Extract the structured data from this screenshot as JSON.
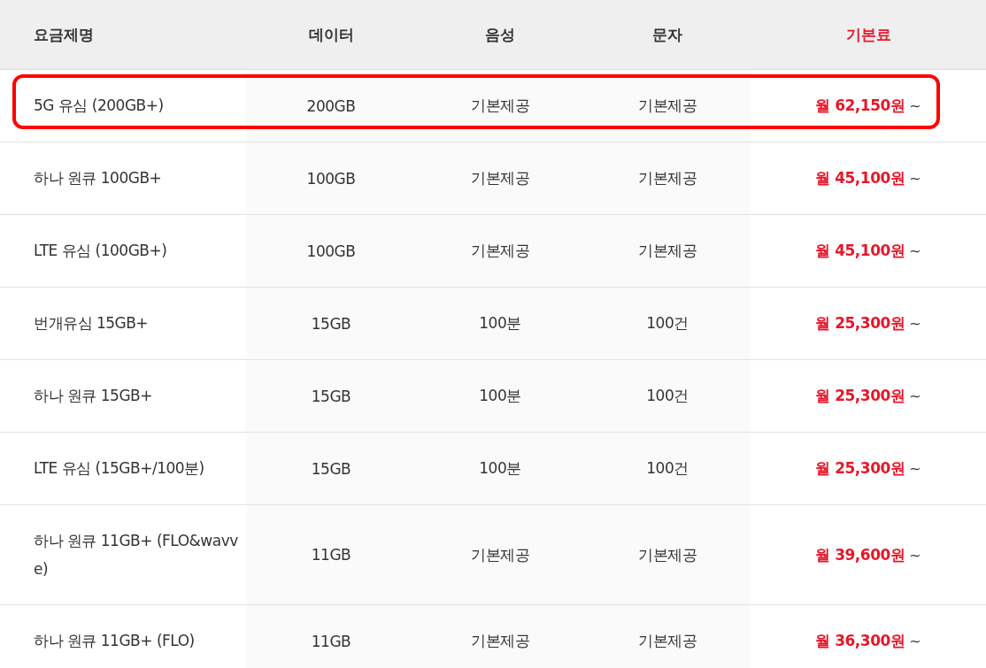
{
  "table": {
    "columns": [
      {
        "label": "요금제명",
        "accent": false
      },
      {
        "label": "데이터",
        "accent": false
      },
      {
        "label": "음성",
        "accent": false
      },
      {
        "label": "문자",
        "accent": false
      },
      {
        "label": "기본료",
        "accent": true
      }
    ],
    "rows": [
      {
        "name": "5G 유심 (200GB+)",
        "data": "200GB",
        "voice": "기본제공",
        "sms": "기본제공",
        "price": "월 62,150원",
        "suffix": "~",
        "highlighted": true
      },
      {
        "name": "하나 원큐 100GB+",
        "data": "100GB",
        "voice": "기본제공",
        "sms": "기본제공",
        "price": "월 45,100원",
        "suffix": "~",
        "highlighted": false
      },
      {
        "name": "LTE 유심 (100GB+)",
        "data": "100GB",
        "voice": "기본제공",
        "sms": "기본제공",
        "price": "월 45,100원",
        "suffix": "~",
        "highlighted": false
      },
      {
        "name": "번개유심 15GB+",
        "data": "15GB",
        "voice": "100분",
        "sms": "100건",
        "price": "월 25,300원",
        "suffix": "~",
        "highlighted": false
      },
      {
        "name": "하나 원큐 15GB+",
        "data": "15GB",
        "voice": "100분",
        "sms": "100건",
        "price": "월 25,300원",
        "suffix": "~",
        "highlighted": false
      },
      {
        "name": "LTE 유심 (15GB+/100분)",
        "data": "15GB",
        "voice": "100분",
        "sms": "100건",
        "price": "월 25,300원",
        "suffix": "~",
        "highlighted": false
      },
      {
        "name": "하나 원큐 11GB+ (FLO&wavve)",
        "data": "11GB",
        "voice": "기본제공",
        "sms": "기본제공",
        "price": "월 39,600원",
        "suffix": "~",
        "highlighted": false
      },
      {
        "name": "하나 원큐 11GB+ (FLO)",
        "data": "11GB",
        "voice": "기본제공",
        "sms": "기본제공",
        "price": "월 36,300원",
        "suffix": "~",
        "highlighted": false
      }
    ]
  }
}
